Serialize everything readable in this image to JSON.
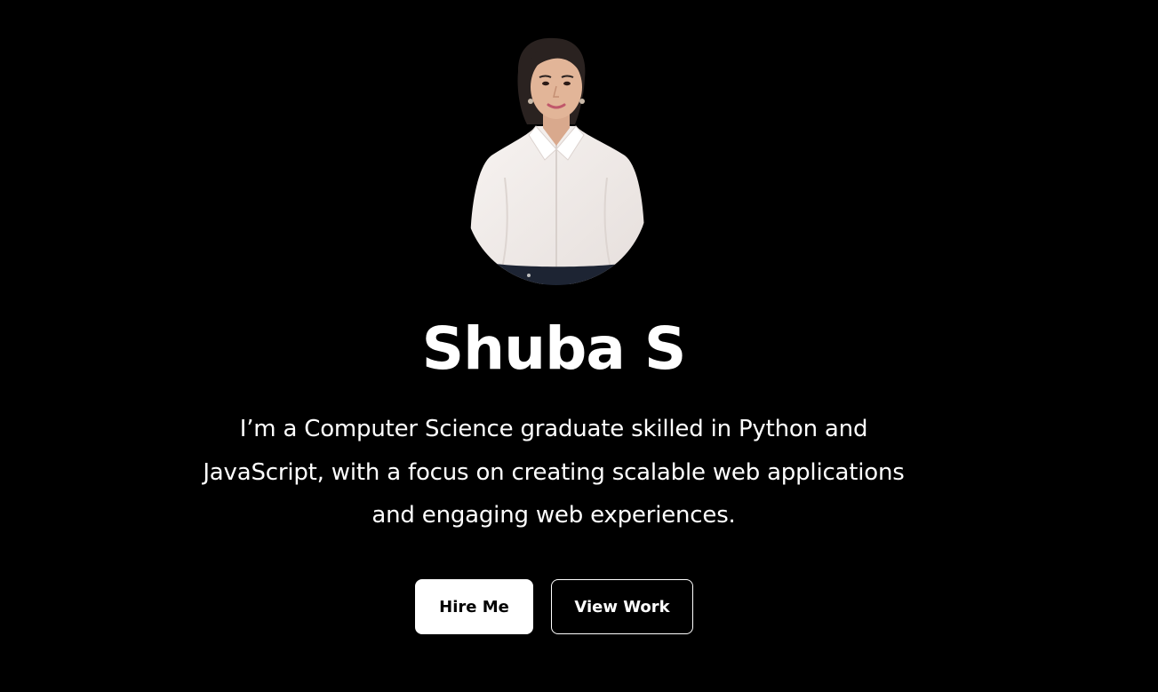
{
  "profile": {
    "name": "Shuba S",
    "bio_line_1": "I’m a Computer Science graduate skilled in Python and",
    "bio_line_2": "JavaScript, with a focus on creating scalable web applications",
    "bio_line_3": "and engaging web experiences.",
    "photo_icon": "profile-photo"
  },
  "actions": {
    "hire_label": "Hire Me",
    "work_label": "View Work"
  },
  "colors": {
    "background": "#000000",
    "text": "#ffffff",
    "primary_button_bg": "#ffffff",
    "primary_button_text": "#000000"
  }
}
